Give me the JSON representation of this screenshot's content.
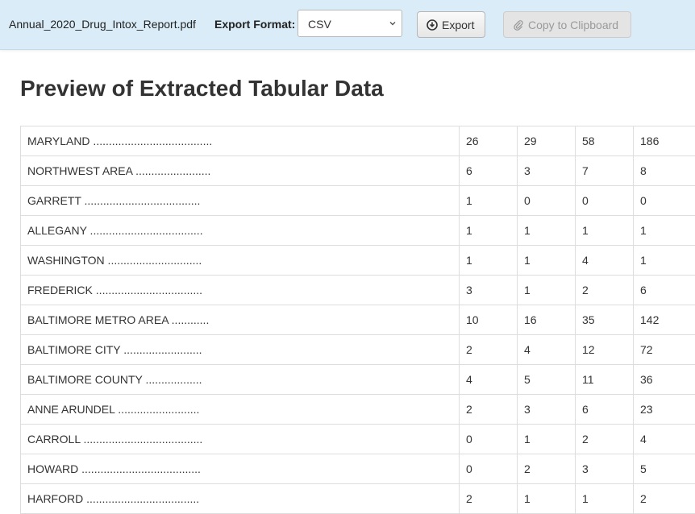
{
  "toolbar": {
    "filename": "Annual_2020_Drug_Intox_Report.pdf",
    "format_label": "Export Format:",
    "format_value": "CSV",
    "export_label": "Export",
    "copy_label": "Copy to Clipboard"
  },
  "main": {
    "title": "Preview of Extracted Tabular Data"
  },
  "table": {
    "rows": [
      [
        "MARYLAND ......................................",
        "26",
        "29",
        "58",
        "186"
      ],
      [
        "NORTHWEST AREA ........................",
        "6",
        "3",
        "7",
        "8"
      ],
      [
        "GARRETT .....................................",
        "1",
        "0",
        "0",
        "0"
      ],
      [
        "ALLEGANY ....................................",
        "1",
        "1",
        "1",
        "1"
      ],
      [
        "WASHINGTON ..............................",
        "1",
        "1",
        "4",
        "1"
      ],
      [
        "FREDERICK ..................................",
        "3",
        "1",
        "2",
        "6"
      ],
      [
        "BALTIMORE METRO AREA ............",
        "10",
        "16",
        "35",
        "142"
      ],
      [
        "BALTIMORE CITY .........................",
        "2",
        "4",
        "12",
        "72"
      ],
      [
        "BALTIMORE COUNTY ..................",
        "4",
        "5",
        "11",
        "36"
      ],
      [
        "ANNE ARUNDEL ..........................",
        "2",
        "3",
        "6",
        "23"
      ],
      [
        "CARROLL ......................................",
        "0",
        "1",
        "2",
        "4"
      ],
      [
        "HOWARD ......................................",
        "0",
        "2",
        "3",
        "5"
      ],
      [
        "HARFORD ....................................",
        "2",
        "1",
        "1",
        "2"
      ]
    ]
  }
}
